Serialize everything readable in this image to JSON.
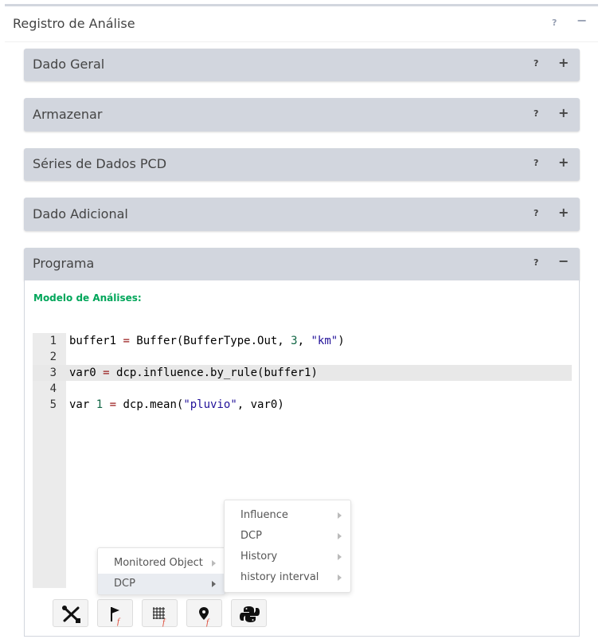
{
  "outer": {
    "title": "Registro de Análise",
    "help": "?",
    "collapse": "−"
  },
  "panels": [
    {
      "title": "Dado Geral",
      "help": "?",
      "toggle": "+"
    },
    {
      "title": "Armazenar",
      "help": "?",
      "toggle": "+"
    },
    {
      "title": "Séries de Dados PCD",
      "help": "?",
      "toggle": "+"
    },
    {
      "title": "Dado Adicional",
      "help": "?",
      "toggle": "+"
    },
    {
      "title": "Programa",
      "help": "?",
      "toggle": "−"
    }
  ],
  "program": {
    "model_label": "Modelo de Análises:",
    "line_numbers": [
      "1",
      "2",
      "3",
      "4",
      "5"
    ],
    "code": [
      "buffer1 = Buffer(BufferType.Out, 3, \"km\")",
      "",
      "var0 = dcp.influence.by_rule(buffer1)",
      "",
      "var 1 = dcp.mean(\"pluvio\", var0)"
    ]
  },
  "context_menu": {
    "main": [
      "Monitored Object",
      "DCP"
    ],
    "active_item": "DCP",
    "submenu": [
      "Influence",
      "DCP",
      "History",
      "history interval"
    ]
  },
  "toolbar": {
    "buttons": [
      "tools-icon",
      "flag-function-icon",
      "grid-function-icon",
      "pin-function-icon",
      "python-icon"
    ]
  },
  "colors": {
    "panel_header": "#d2d6de",
    "model_label": "#00a65a",
    "function_red": "#dd4b39",
    "python_blue": "#3776ab"
  }
}
